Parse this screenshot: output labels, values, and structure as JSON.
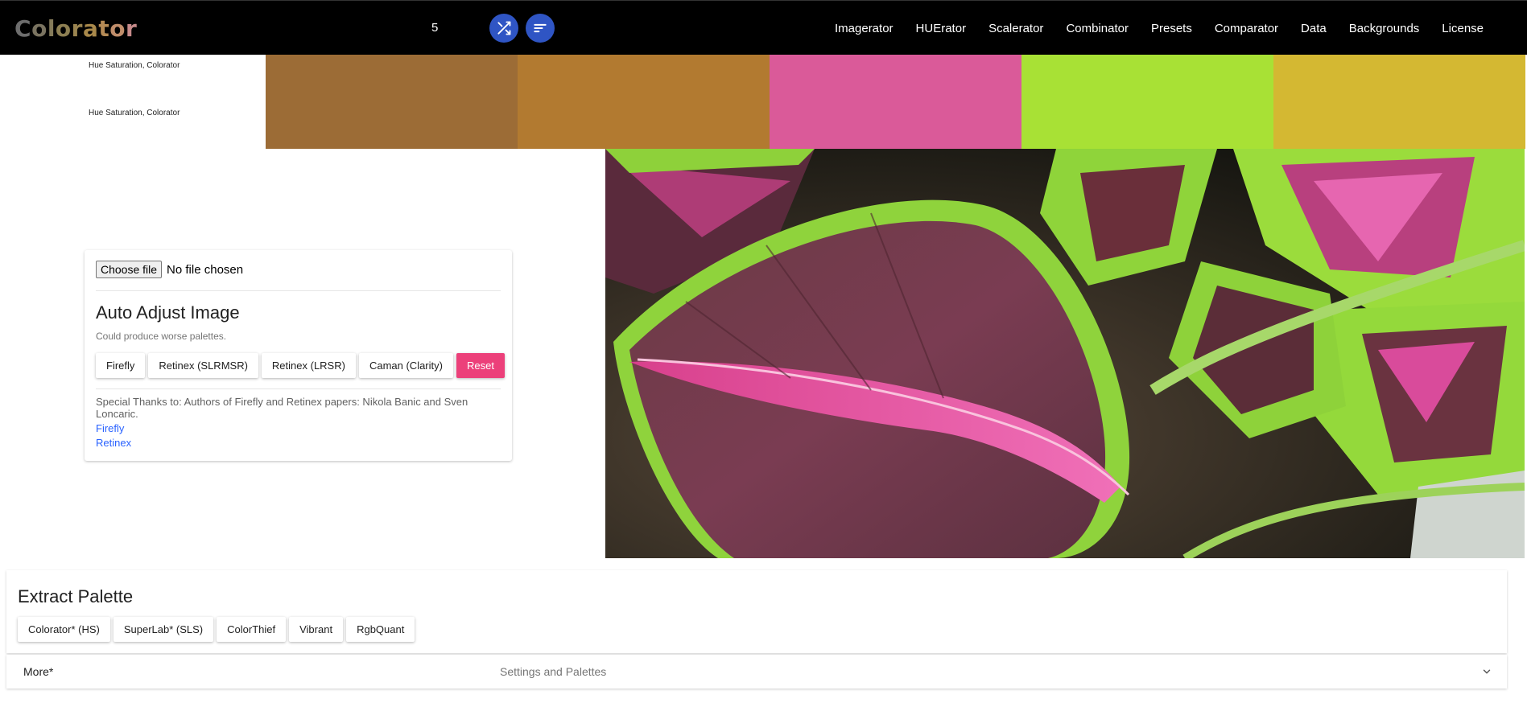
{
  "app": {
    "logo_letters": [
      {
        "ch": "C",
        "color": "#6d6d6d"
      },
      {
        "ch": "o",
        "color": "#7a7360"
      },
      {
        "ch": "l",
        "color": "#857b5a"
      },
      {
        "ch": "o",
        "color": "#8d7f52"
      },
      {
        "ch": "r",
        "color": "#9a8450"
      },
      {
        "ch": "a",
        "color": "#a8884a"
      },
      {
        "ch": "t",
        "color": "#b48a55"
      },
      {
        "ch": "o",
        "color": "#c08d6a"
      },
      {
        "ch": "r",
        "color": "#c68a8a"
      }
    ],
    "count": "5",
    "buttons": {
      "shuffle_icon": "shuffle-icon",
      "sort_icon": "sort-icon"
    },
    "nav": [
      "Imagerator",
      "HUErator",
      "Scalerator",
      "Combinator",
      "Presets",
      "Comparator",
      "Data",
      "Backgrounds",
      "License"
    ]
  },
  "palette": {
    "labels": [
      "Hue Saturation, Colorator",
      "Hue Saturation, Colorator"
    ],
    "swatches": [
      "#9c6c36",
      "#b27a30",
      "#da5a99",
      "#a8e135",
      "#d4b832"
    ]
  },
  "adjust": {
    "file_button": "Choose file",
    "file_status": "No file chosen",
    "title": "Auto Adjust Image",
    "subtitle": "Could produce worse palettes.",
    "buttons": [
      "Firefly",
      "Retinex (SLRMSR)",
      "Retinex (LRSR)",
      "Caman (Clarity)",
      "Reset"
    ],
    "thanks": "Special Thanks to: Authors of Firefly and Retinex papers: Nikola Banic and Sven Loncaric.",
    "links": [
      "Firefly",
      "Retinex"
    ]
  },
  "extract": {
    "title": "Extract Palette",
    "buttons": [
      "Colorator* (HS)",
      "SuperLab* (SLS)",
      "ColorThief",
      "Vibrant",
      "RgbQuant"
    ]
  },
  "more": {
    "label": "More*",
    "sub": "Settings and Palettes",
    "icon": "chevron-down-icon"
  }
}
